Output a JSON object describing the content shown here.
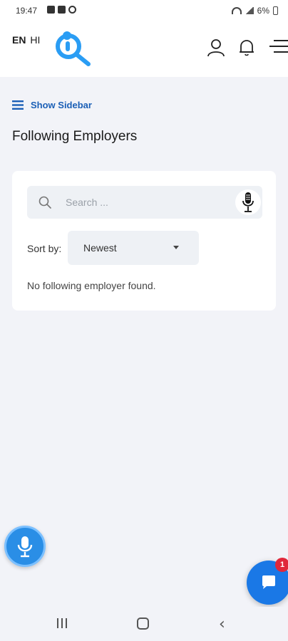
{
  "status_bar": {
    "time": "19:47",
    "battery": "6%"
  },
  "header": {
    "lang_en": "EN",
    "lang_hi": "HI",
    "logo_icon": "magnifier-logo-icon",
    "icons": [
      "user-icon",
      "bell-icon",
      "menu-icon"
    ]
  },
  "sidebar_toggle": {
    "label": "Show Sidebar"
  },
  "page": {
    "title": "Following Employers"
  },
  "search": {
    "placeholder": "Search ...",
    "value": ""
  },
  "sort": {
    "label": "Sort by:",
    "selected": "Newest"
  },
  "empty_message": "No following employer found.",
  "chat": {
    "badge_count": "1"
  },
  "colors": {
    "accent": "#1b5fb6",
    "logo": "#2a9df4",
    "fab": "#2a8ee6",
    "badge": "#e0273a"
  }
}
